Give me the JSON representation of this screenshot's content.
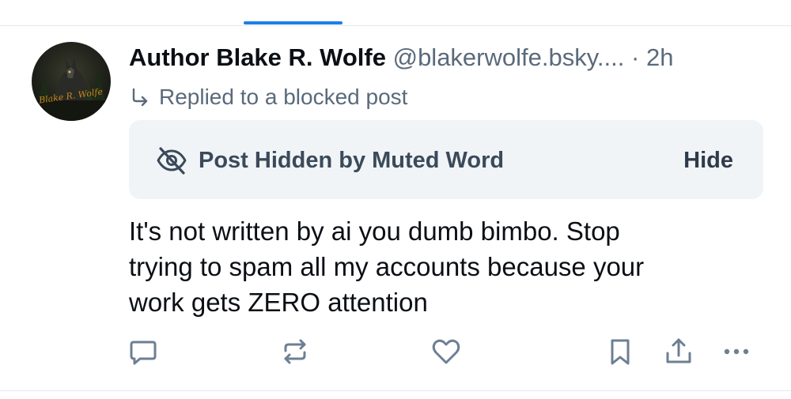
{
  "post": {
    "author_name": "Author Blake R. Wolfe",
    "handle": "@blakerwolfe.bsky....",
    "separator": "·",
    "timestamp": "2h",
    "avatar_text": "Blake R. Wolfe",
    "reply_status": "Replied to a blocked post",
    "hidden_notice": {
      "label": "Post Hidden by Muted Word",
      "button_label": "Hide"
    },
    "text_lines": [
      "It's not written by ai you dumb bimbo. Stop",
      "trying to spam all my accounts because your",
      "work gets ZERO attention"
    ]
  },
  "actions": {
    "reply_icon": "speech-bubble-icon",
    "repost_icon": "repost-arrows-icon",
    "like_icon": "heart-icon",
    "bookmark_icon": "bookmark-icon",
    "share_icon": "share-upload-icon",
    "more_icon": "ellipsis-icon"
  },
  "colors": {
    "accent": "#1d7ee8",
    "secondary_text": "#5a6a7b",
    "card_background": "#f1f4f7",
    "icon": "#6d7f93"
  }
}
